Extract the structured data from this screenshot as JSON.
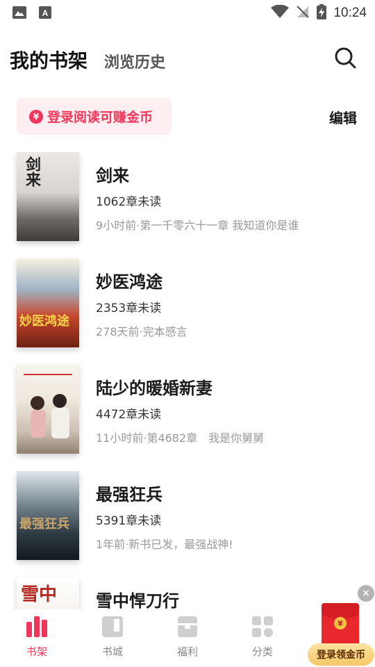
{
  "status_bar": {
    "time": "10:24",
    "icons": [
      "image-icon",
      "font-icon",
      "wifi-icon",
      "no-signal-icon",
      "battery-charging-icon"
    ]
  },
  "header": {
    "title": "我的书架",
    "subtitle": "浏览历史",
    "search_icon": "search-icon"
  },
  "promo": {
    "coin_symbol": "¥",
    "text": "登录阅读可赚金币"
  },
  "edit_label": "编辑",
  "books": [
    {
      "title": "剑来",
      "unread": "1062章未读",
      "latest": "9小时前·第一千零六十一章 我知道你是谁",
      "cover_text": "剑来"
    },
    {
      "title": "妙医鸿途",
      "unread": "2353章未读",
      "latest": "278天前·完本感言",
      "cover_text": "妙医鸿途"
    },
    {
      "title": "陆少的暖婚新妻",
      "unread": "4472章未读",
      "latest": "11小时前·第4682章　我是你舅舅",
      "cover_text": ""
    },
    {
      "title": "最强狂兵",
      "unread": "5391章未读",
      "latest": "1年前·新书已发，最强战神!",
      "cover_text": "最强狂兵"
    },
    {
      "title": "雪中悍刀行",
      "unread": "",
      "latest": "",
      "cover_text": "雪中"
    }
  ],
  "bottom_nav": [
    {
      "label": "书架",
      "icon": "bookshelf-icon",
      "active": true
    },
    {
      "label": "书城",
      "icon": "book-icon",
      "active": false
    },
    {
      "label": "福利",
      "icon": "gift-icon",
      "active": false
    },
    {
      "label": "分类",
      "icon": "category-icon",
      "active": false
    }
  ],
  "floating": {
    "close_symbol": "×",
    "coin_symbol": "¥",
    "cta_label": "登录领金币"
  },
  "colors": {
    "accent": "#f0375b",
    "promo_bg": "#fdeef1",
    "nav_inactive": "#cfcfcf"
  }
}
